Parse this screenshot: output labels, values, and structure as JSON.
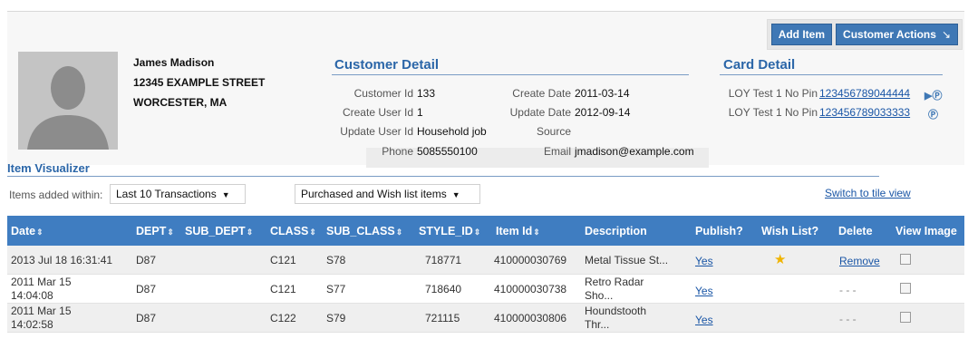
{
  "actions": {
    "add_item": "Add Item",
    "customer_actions": "Customer Actions",
    "customer_actions_icon": "arrow-down-right-icon"
  },
  "customer": {
    "name": "James Madison",
    "street": "12345 EXAMPLE STREET",
    "city": "WORCESTER, MA"
  },
  "customer_detail": {
    "title": "Customer Detail",
    "fields": {
      "customer_id_label": "Customer Id",
      "customer_id": "133",
      "create_user_id_label": "Create User Id",
      "create_user_id": "1",
      "update_user_id_label": "Update User Id",
      "update_user_id": "Household job",
      "phone_label": "Phone",
      "phone": "5085550100",
      "create_date_label": "Create Date",
      "create_date": "2011-03-14",
      "update_date_label": "Update Date",
      "update_date": "2012-09-14",
      "source_label": "Source",
      "source": "",
      "email_label": "Email",
      "email": "jmadison@example.com"
    }
  },
  "card_detail": {
    "title": "Card Detail",
    "cards": [
      {
        "label": "LOY Test 1 No Pin",
        "number": "123456789044444"
      },
      {
        "label": "LOY Test 1 No Pin",
        "number": "123456789033333"
      }
    ]
  },
  "visualizer": {
    "title": "Item Visualizer",
    "filter_label": "Items added within:",
    "range_value": "Last 10 Transactions",
    "type_value": "Purchased and Wish list items",
    "tile_view_link": "Switch to tile view"
  },
  "table": {
    "headers": [
      "Date",
      "DEPT",
      "SUB_DEPT",
      "CLASS",
      "SUB_CLASS",
      "STYLE_ID",
      "Item Id",
      "Description",
      "Publish?",
      "Wish List?",
      "Delete",
      "View Image"
    ],
    "rows": [
      {
        "date": "2013 Jul 18 16:31:41",
        "dept": "D87",
        "sub_dept": "",
        "class": "C121",
        "sub_class": "S78",
        "style_id": "718771",
        "item_id": "410000030769",
        "description": "Metal Tissue St...",
        "publish": "Yes",
        "wish": "star",
        "delete": "Remove"
      },
      {
        "date": "2011 Mar 15 14:04:08",
        "dept": "D87",
        "sub_dept": "",
        "class": "C121",
        "sub_class": "S77",
        "style_id": "718640",
        "item_id": "410000030738",
        "description": "Retro Radar Sho...",
        "publish": "Yes",
        "wish": "",
        "delete": "- - -"
      },
      {
        "date": "2011 Mar 15 14:02:58",
        "dept": "D87",
        "sub_dept": "",
        "class": "C122",
        "sub_class": "S79",
        "style_id": "721115",
        "item_id": "410000030806",
        "description": "Houndstooth Thr...",
        "publish": "Yes",
        "wish": "",
        "delete": "- - -"
      }
    ]
  },
  "colors": {
    "header_blue": "#3f7dc1",
    "title_blue": "#2b66a8",
    "link_blue": "#1a56a6",
    "star": "#f0b400"
  }
}
